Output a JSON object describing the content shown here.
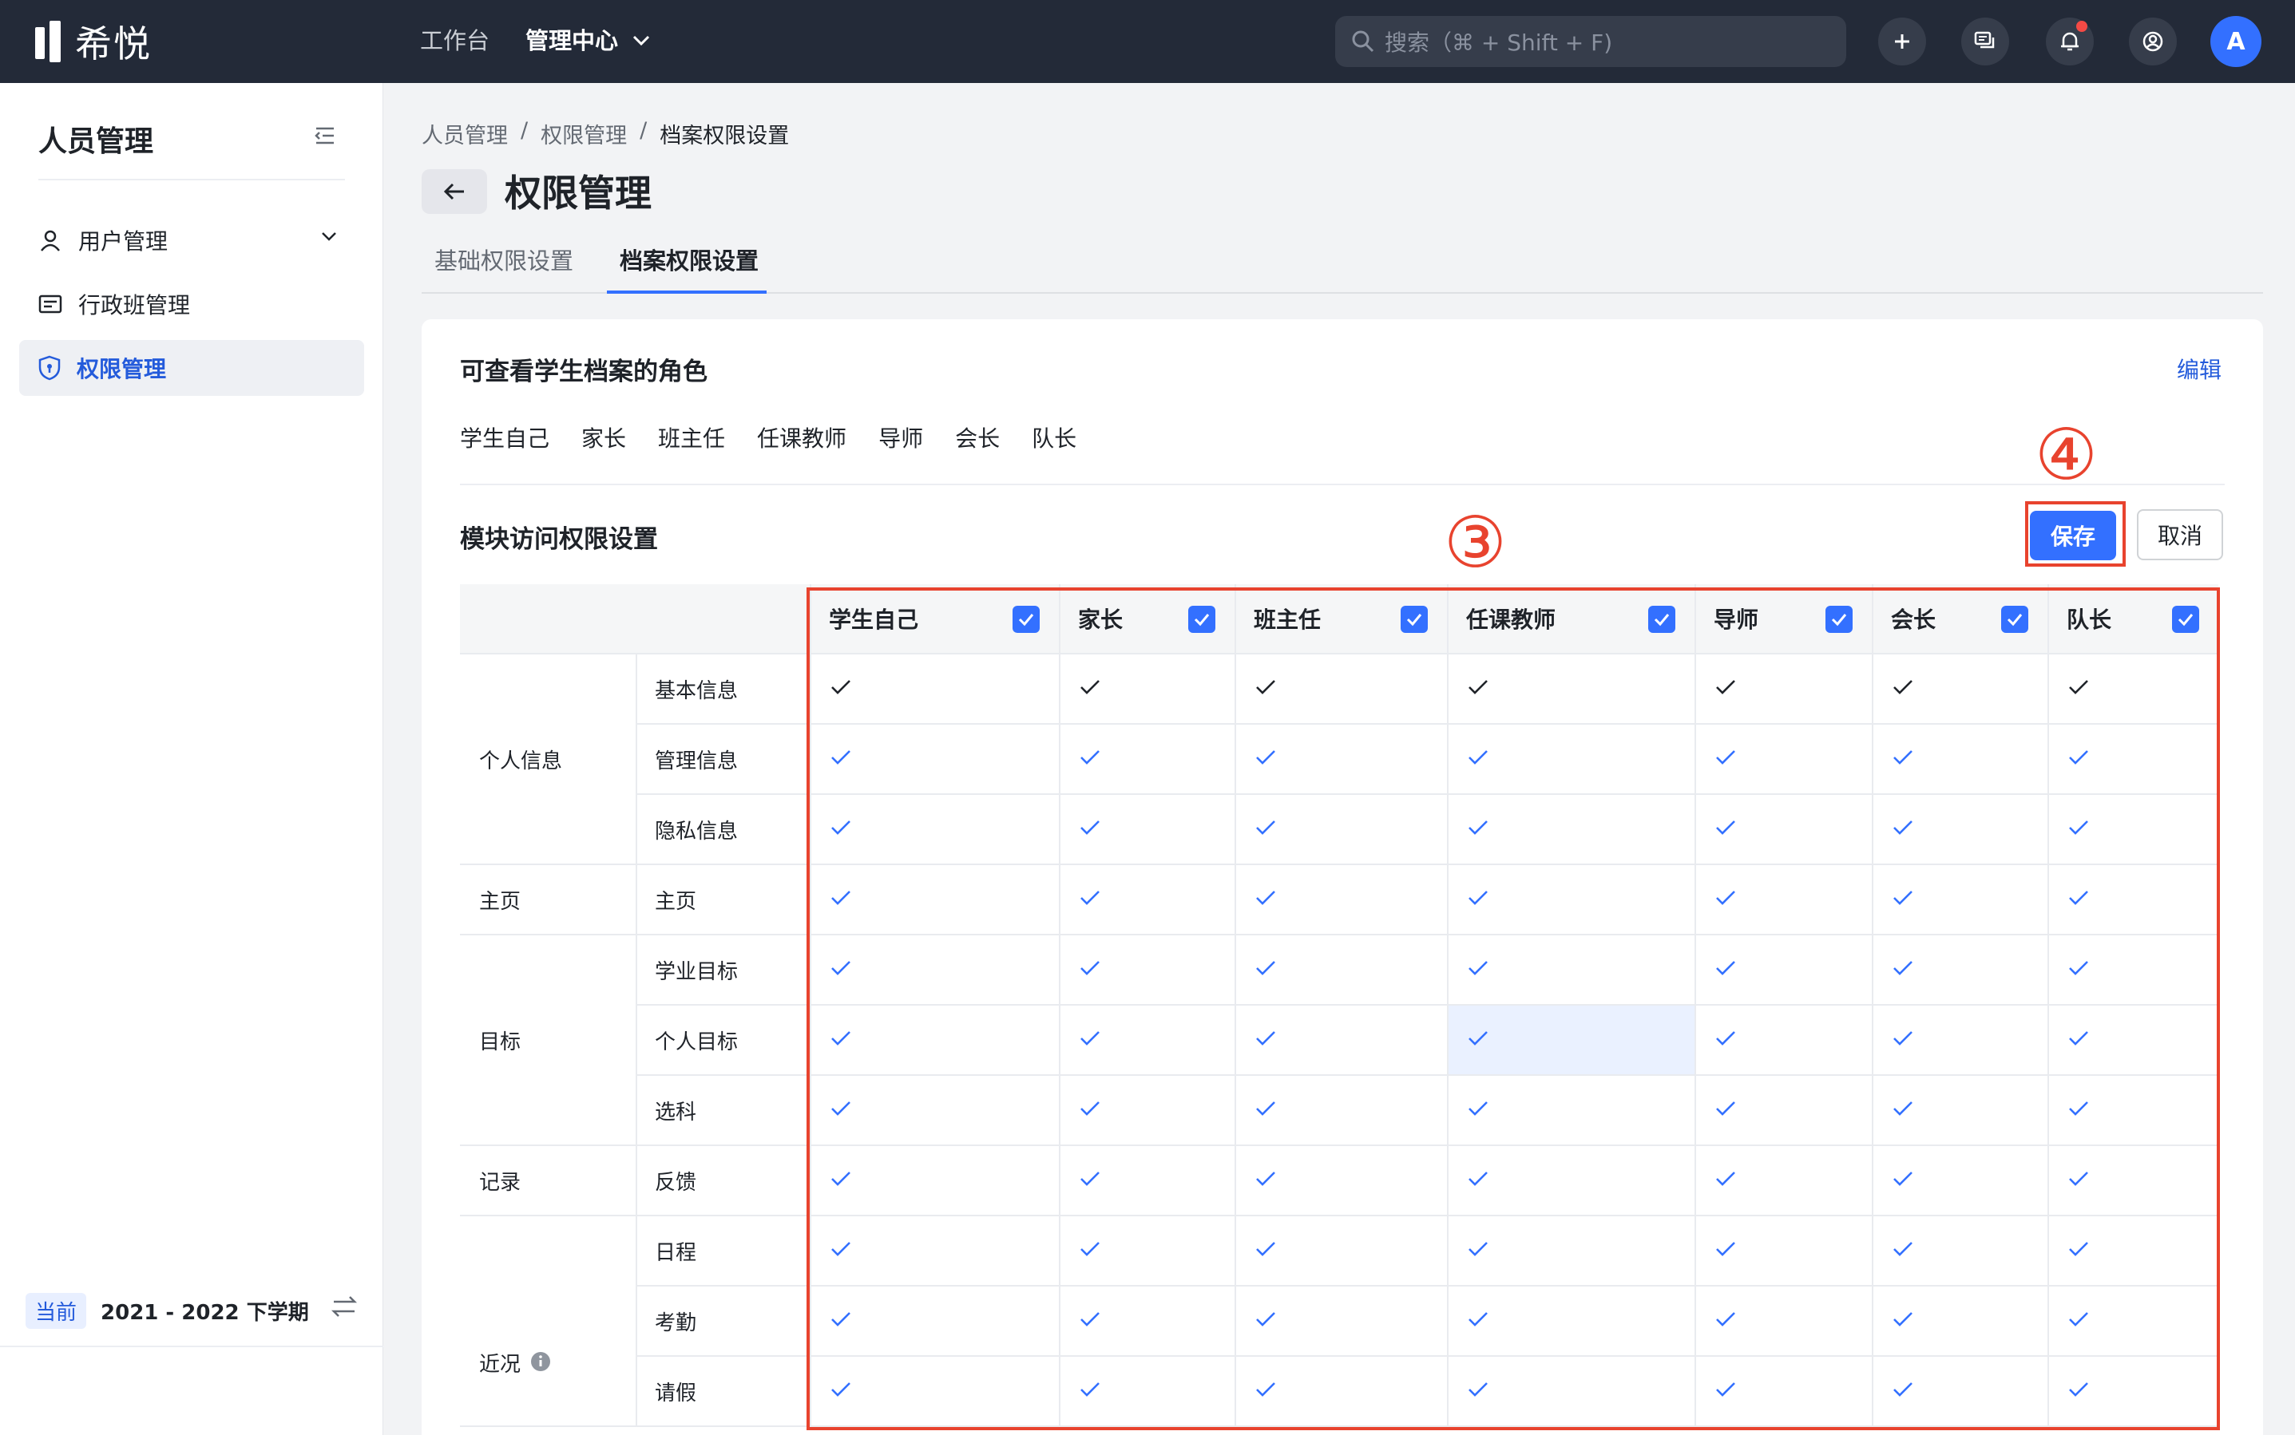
{
  "topbar": {
    "logo_text": "希悦",
    "nav": [
      {
        "label": "工作台"
      },
      {
        "label": "管理中心"
      }
    ],
    "search_placeholder": "搜索（⌘ + Shift + F)",
    "avatar_letter": "A"
  },
  "sidebar": {
    "title": "人员管理",
    "items": [
      {
        "label": "用户管理",
        "icon": "user-icon"
      },
      {
        "label": "行政班管理",
        "icon": "class-icon"
      },
      {
        "label": "权限管理",
        "icon": "shield-icon",
        "active": true
      }
    ],
    "term_badge": "当前",
    "term_text": "2021 - 2022 下学期"
  },
  "breadcrumb": [
    "人员管理",
    "/",
    "权限管理",
    "/",
    "档案权限设置"
  ],
  "page_title": "权限管理",
  "tabs": [
    {
      "label": "基础权限设置"
    },
    {
      "label": "档案权限设置",
      "active": true
    }
  ],
  "roles_section": {
    "title": "可查看学生档案的角色",
    "edit_label": "编辑",
    "roles": [
      "学生自己",
      "家长",
      "班主任",
      "任课教师",
      "导师",
      "会长",
      "队长"
    ]
  },
  "module_section": {
    "title": "模块访问权限设置",
    "save_label": "保存",
    "cancel_label": "取消"
  },
  "annotations": {
    "three": "③",
    "four": "④"
  },
  "table": {
    "columns": [
      "学生自己",
      "家长",
      "班主任",
      "任课教师",
      "导师",
      "会长",
      "队长"
    ],
    "groups": [
      {
        "label": "个人信息",
        "rows": [
          "基本信息",
          "管理信息",
          "隐私信息"
        ]
      },
      {
        "label": "主页",
        "rows": [
          "主页"
        ]
      },
      {
        "label": "目标",
        "rows": [
          "学业目标",
          "个人目标",
          "选科"
        ]
      },
      {
        "label": "记录",
        "rows": [
          "反馈"
        ]
      },
      {
        "label": "近况",
        "rows": [
          "日程",
          "考勤",
          "请假"
        ],
        "info_icon": true
      }
    ]
  },
  "colors": {
    "accent": "#3370ff",
    "annotation": "#e8432e",
    "topbar": "#232a38"
  }
}
